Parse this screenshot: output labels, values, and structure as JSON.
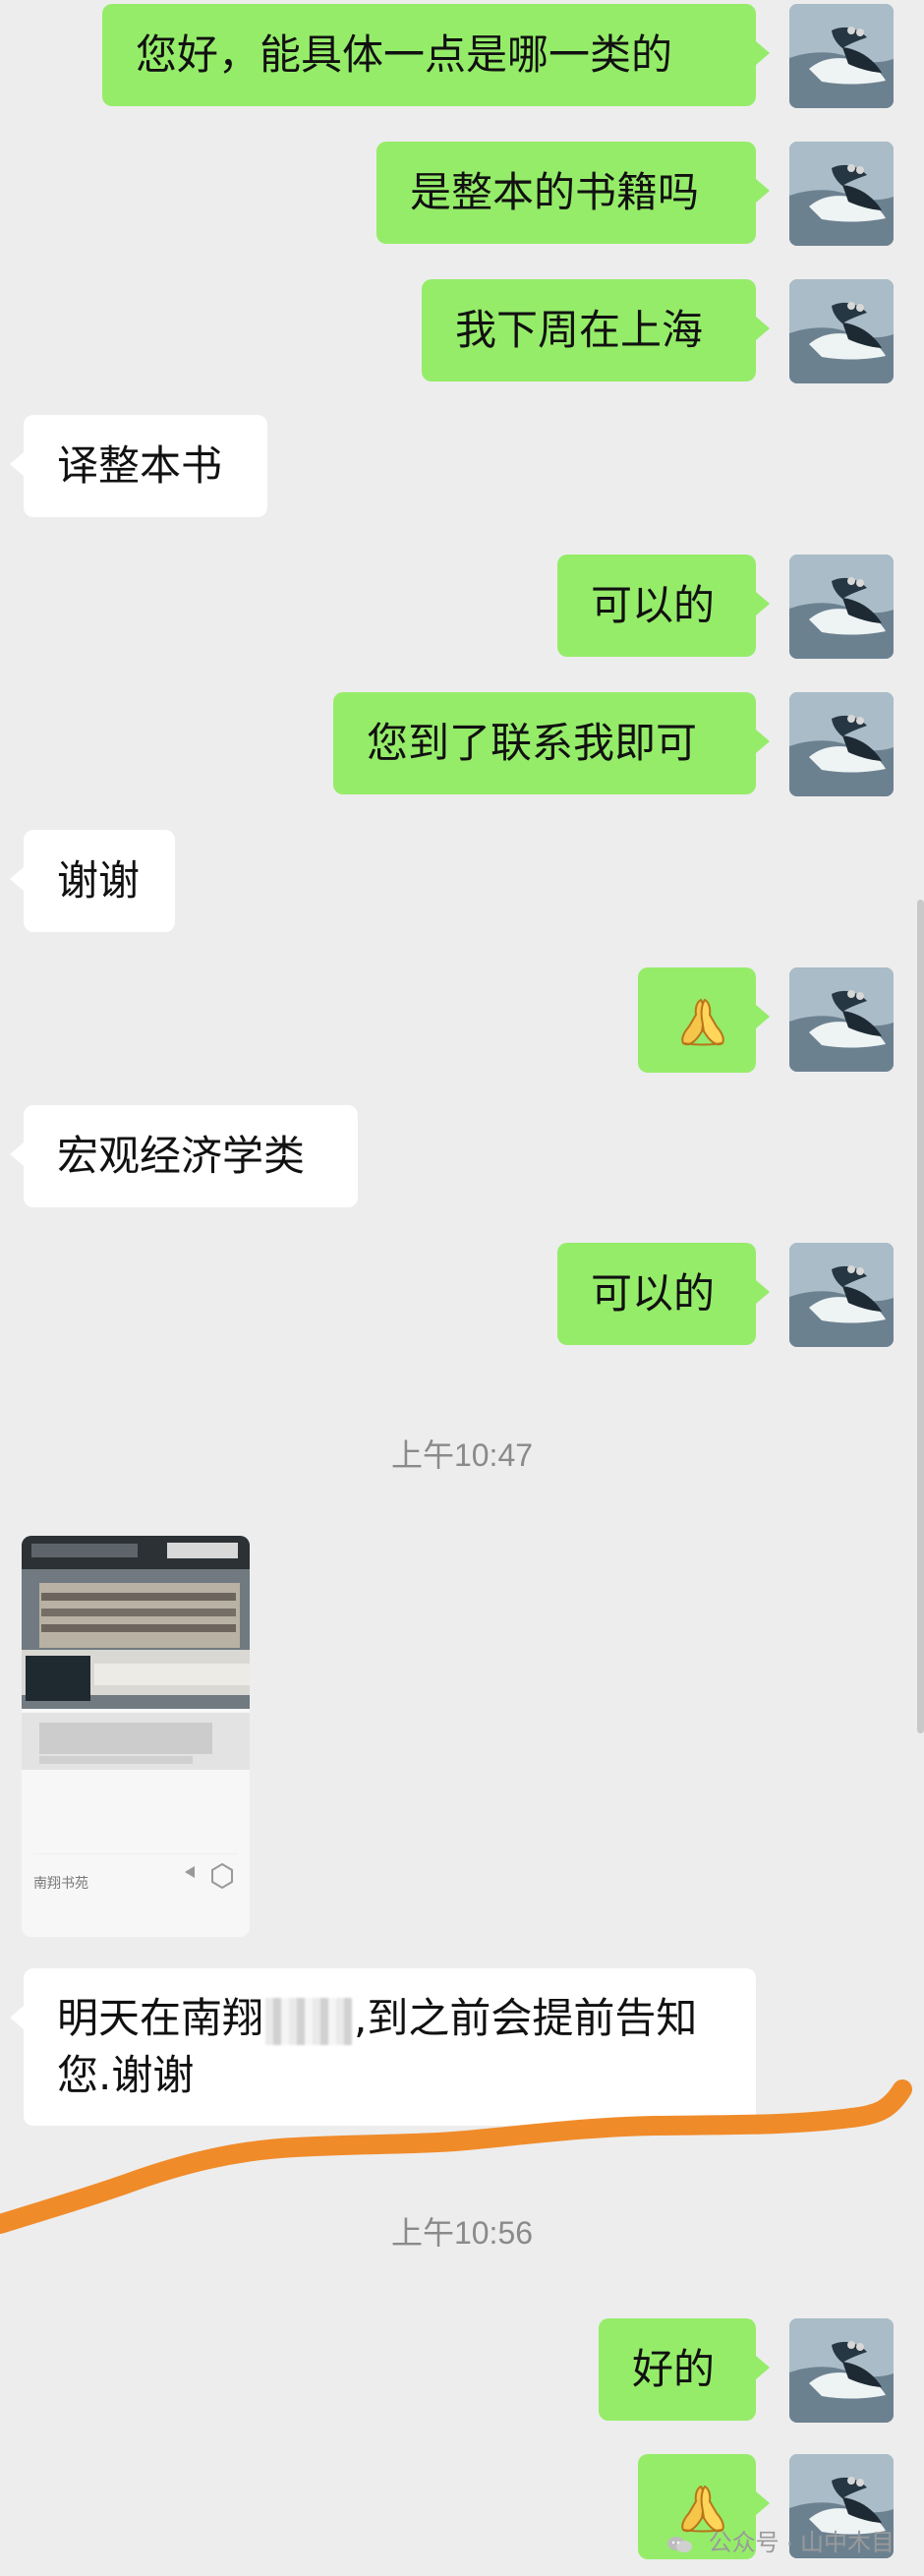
{
  "messages": [
    {
      "side": "out",
      "text": "您好，能具体一点是哪一类的"
    },
    {
      "side": "out",
      "text": "是整本的书籍吗"
    },
    {
      "side": "out",
      "text": "我下周在上海"
    },
    {
      "side": "in",
      "text": "译整本书"
    },
    {
      "side": "out",
      "text": "可以的"
    },
    {
      "side": "out",
      "text": "您到了联系我即可"
    },
    {
      "side": "in",
      "text": "谢谢"
    },
    {
      "side": "out",
      "emoji": "prayer-hands-icon"
    },
    {
      "side": "in",
      "text": "宏观经济学类"
    },
    {
      "side": "out",
      "text": "可以的"
    },
    {
      "side": "out",
      "text": "好的"
    },
    {
      "side": "out",
      "emoji": "prayer-hands-icon"
    }
  ],
  "timestamps": {
    "first": "上午10:47",
    "second": "上午10:56"
  },
  "image_message": {
    "caption": "南翔书苑"
  },
  "long_message": {
    "line_one_before": "明天在南翔",
    "line_one_after": ",到之前会提前告知",
    "line_two": "您.谢谢"
  },
  "watermark": "公众号 · 山中木目",
  "colors": {
    "background": "#ededed",
    "outgoing_bubble": "#95ec69",
    "incoming_bubble": "#ffffff",
    "highlight_stroke": "#f08b2a"
  }
}
